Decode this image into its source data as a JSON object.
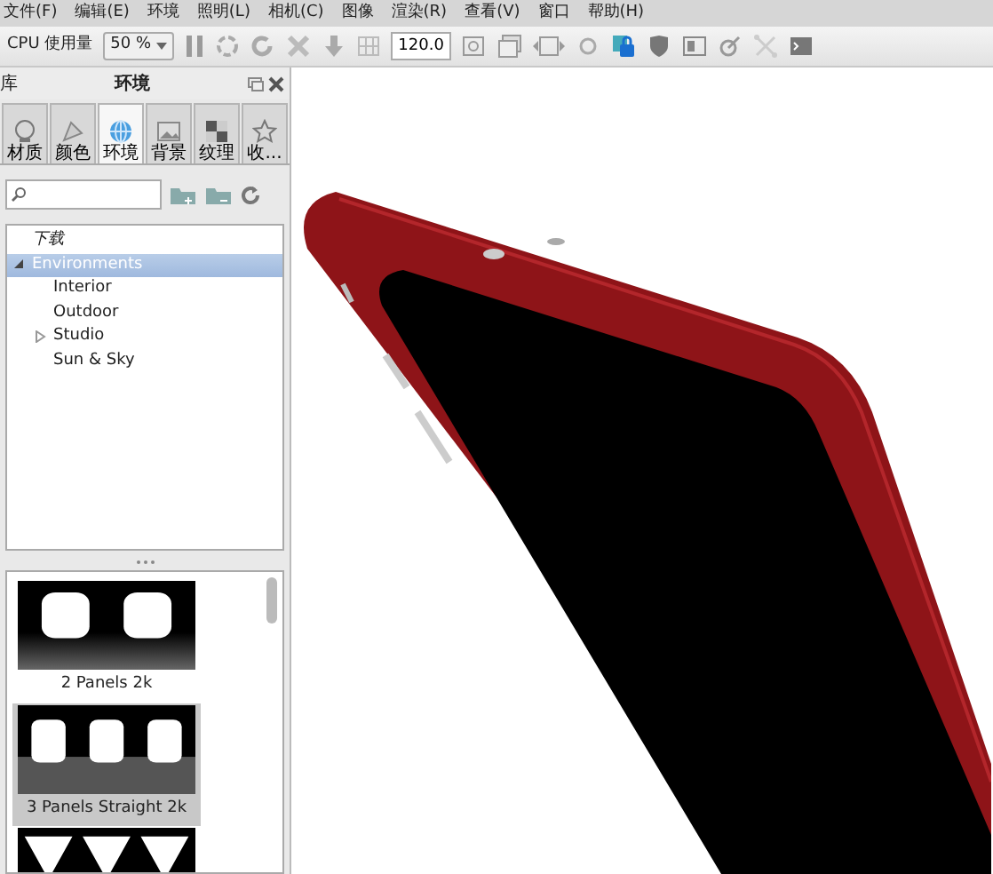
{
  "menu": [
    "文件(F)",
    "编辑(E)",
    "环境",
    "照明(L)",
    "相机(C)",
    "图像",
    "渲染(R)",
    "查看(V)",
    "窗口",
    "帮助(H)"
  ],
  "toolbar": {
    "cpu_label": "CPU 使用量",
    "cpu_select": "50 %",
    "size_value": "120.0"
  },
  "panel": {
    "side_tab": "库",
    "title": "环境",
    "tabs": [
      {
        "label": "材质",
        "kind": "material",
        "selected": false
      },
      {
        "label": "颜色",
        "kind": "color",
        "selected": false
      },
      {
        "label": "环境",
        "kind": "globe",
        "selected": true
      },
      {
        "label": "背景",
        "kind": "picture",
        "selected": false
      },
      {
        "label": "纹理",
        "kind": "texture",
        "selected": false
      },
      {
        "label": "收...",
        "kind": "star",
        "selected": false
      }
    ],
    "tree": [
      {
        "label": "下载",
        "selected": false,
        "italic": true
      },
      {
        "label": "Environments",
        "selected": true,
        "expanded": true,
        "children": [
          {
            "label": "Interior",
            "selected": false
          },
          {
            "label": "Outdoor",
            "selected": false
          },
          {
            "label": "Studio",
            "selected": false,
            "expanded": false
          },
          {
            "label": "Sun & Sky",
            "selected": false
          }
        ]
      }
    ],
    "thumbnails": [
      {
        "label": "2 Panels 2k",
        "kind": "two",
        "selected": false
      },
      {
        "label": "3 Panels Straight 2k",
        "kind": "three",
        "selected": true
      },
      {
        "kind": "cones",
        "selected": false
      }
    ]
  }
}
